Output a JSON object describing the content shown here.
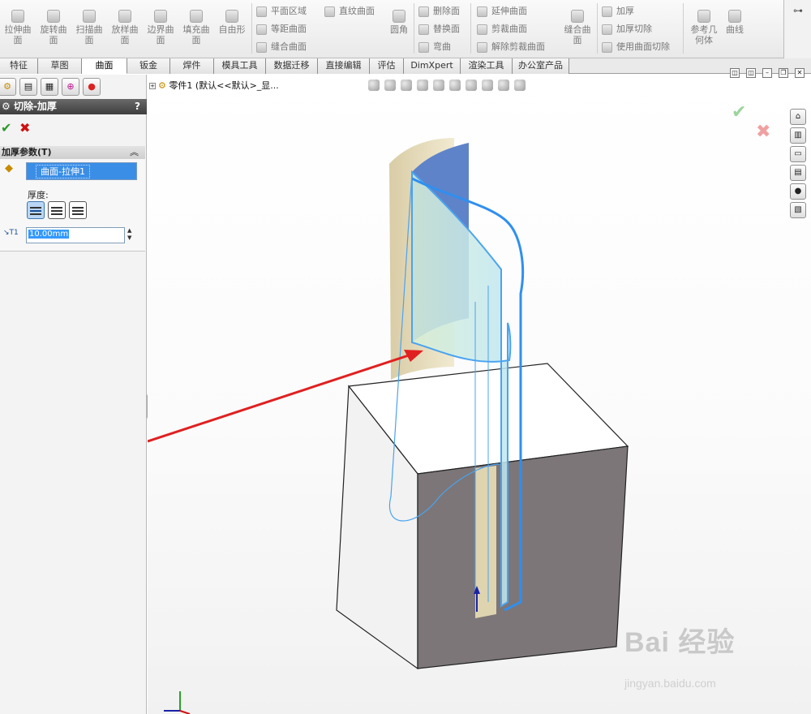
{
  "ribbon": {
    "big_buttons": [
      {
        "label": "拉伸曲\n面",
        "icon": "extruded-surface-icon"
      },
      {
        "label": "旋转曲\n面",
        "icon": "revolved-surface-icon"
      },
      {
        "label": "扫描曲\n面",
        "icon": "swept-surface-icon"
      },
      {
        "label": "放样曲\n面",
        "icon": "lofted-surface-icon"
      },
      {
        "label": "边界曲\n面",
        "icon": "boundary-surface-icon"
      },
      {
        "label": "填充曲\n面",
        "icon": "filled-surface-icon"
      },
      {
        "label": "自由形",
        "icon": "freeform-icon"
      }
    ],
    "col1": [
      "平面区域",
      "等距曲面",
      "缝合曲面"
    ],
    "col2": [
      "直纹曲面"
    ],
    "fillet": "圆角",
    "col3": [
      "删除面",
      "替换面",
      "弯曲"
    ],
    "col4": [
      "延伸曲面",
      "剪裁曲面",
      "解除剪裁曲面"
    ],
    "knit": "缝合曲\n面",
    "col5": [
      "加厚",
      "加厚切除",
      "使用曲面切除"
    ],
    "refgeo": "参考几\n何体",
    "curves": "曲线",
    "right_icon": "⊶"
  },
  "tabs": [
    "特征",
    "草图",
    "曲面",
    "钣金",
    "焊件",
    "模具工具",
    "数据迁移",
    "直接编辑",
    "评估",
    "DimXpert",
    "渲染工具",
    "办公室产品"
  ],
  "active_tab": "曲面",
  "panel": {
    "title": "切除-加厚",
    "help": "?",
    "ok": "✔",
    "cancel": "✖",
    "group_title": "加厚参数(T)",
    "selection": "曲面-拉伸1",
    "thickness_label": "厚度:",
    "thickness_value": "10.00mm"
  },
  "view": {
    "tree_label": "零件1  (默认<<默认>_显...",
    "accept": "✔",
    "reject": "✖"
  },
  "watermark": {
    "line1": "Bai  经验",
    "line2": "jingyan.baidu.com"
  }
}
